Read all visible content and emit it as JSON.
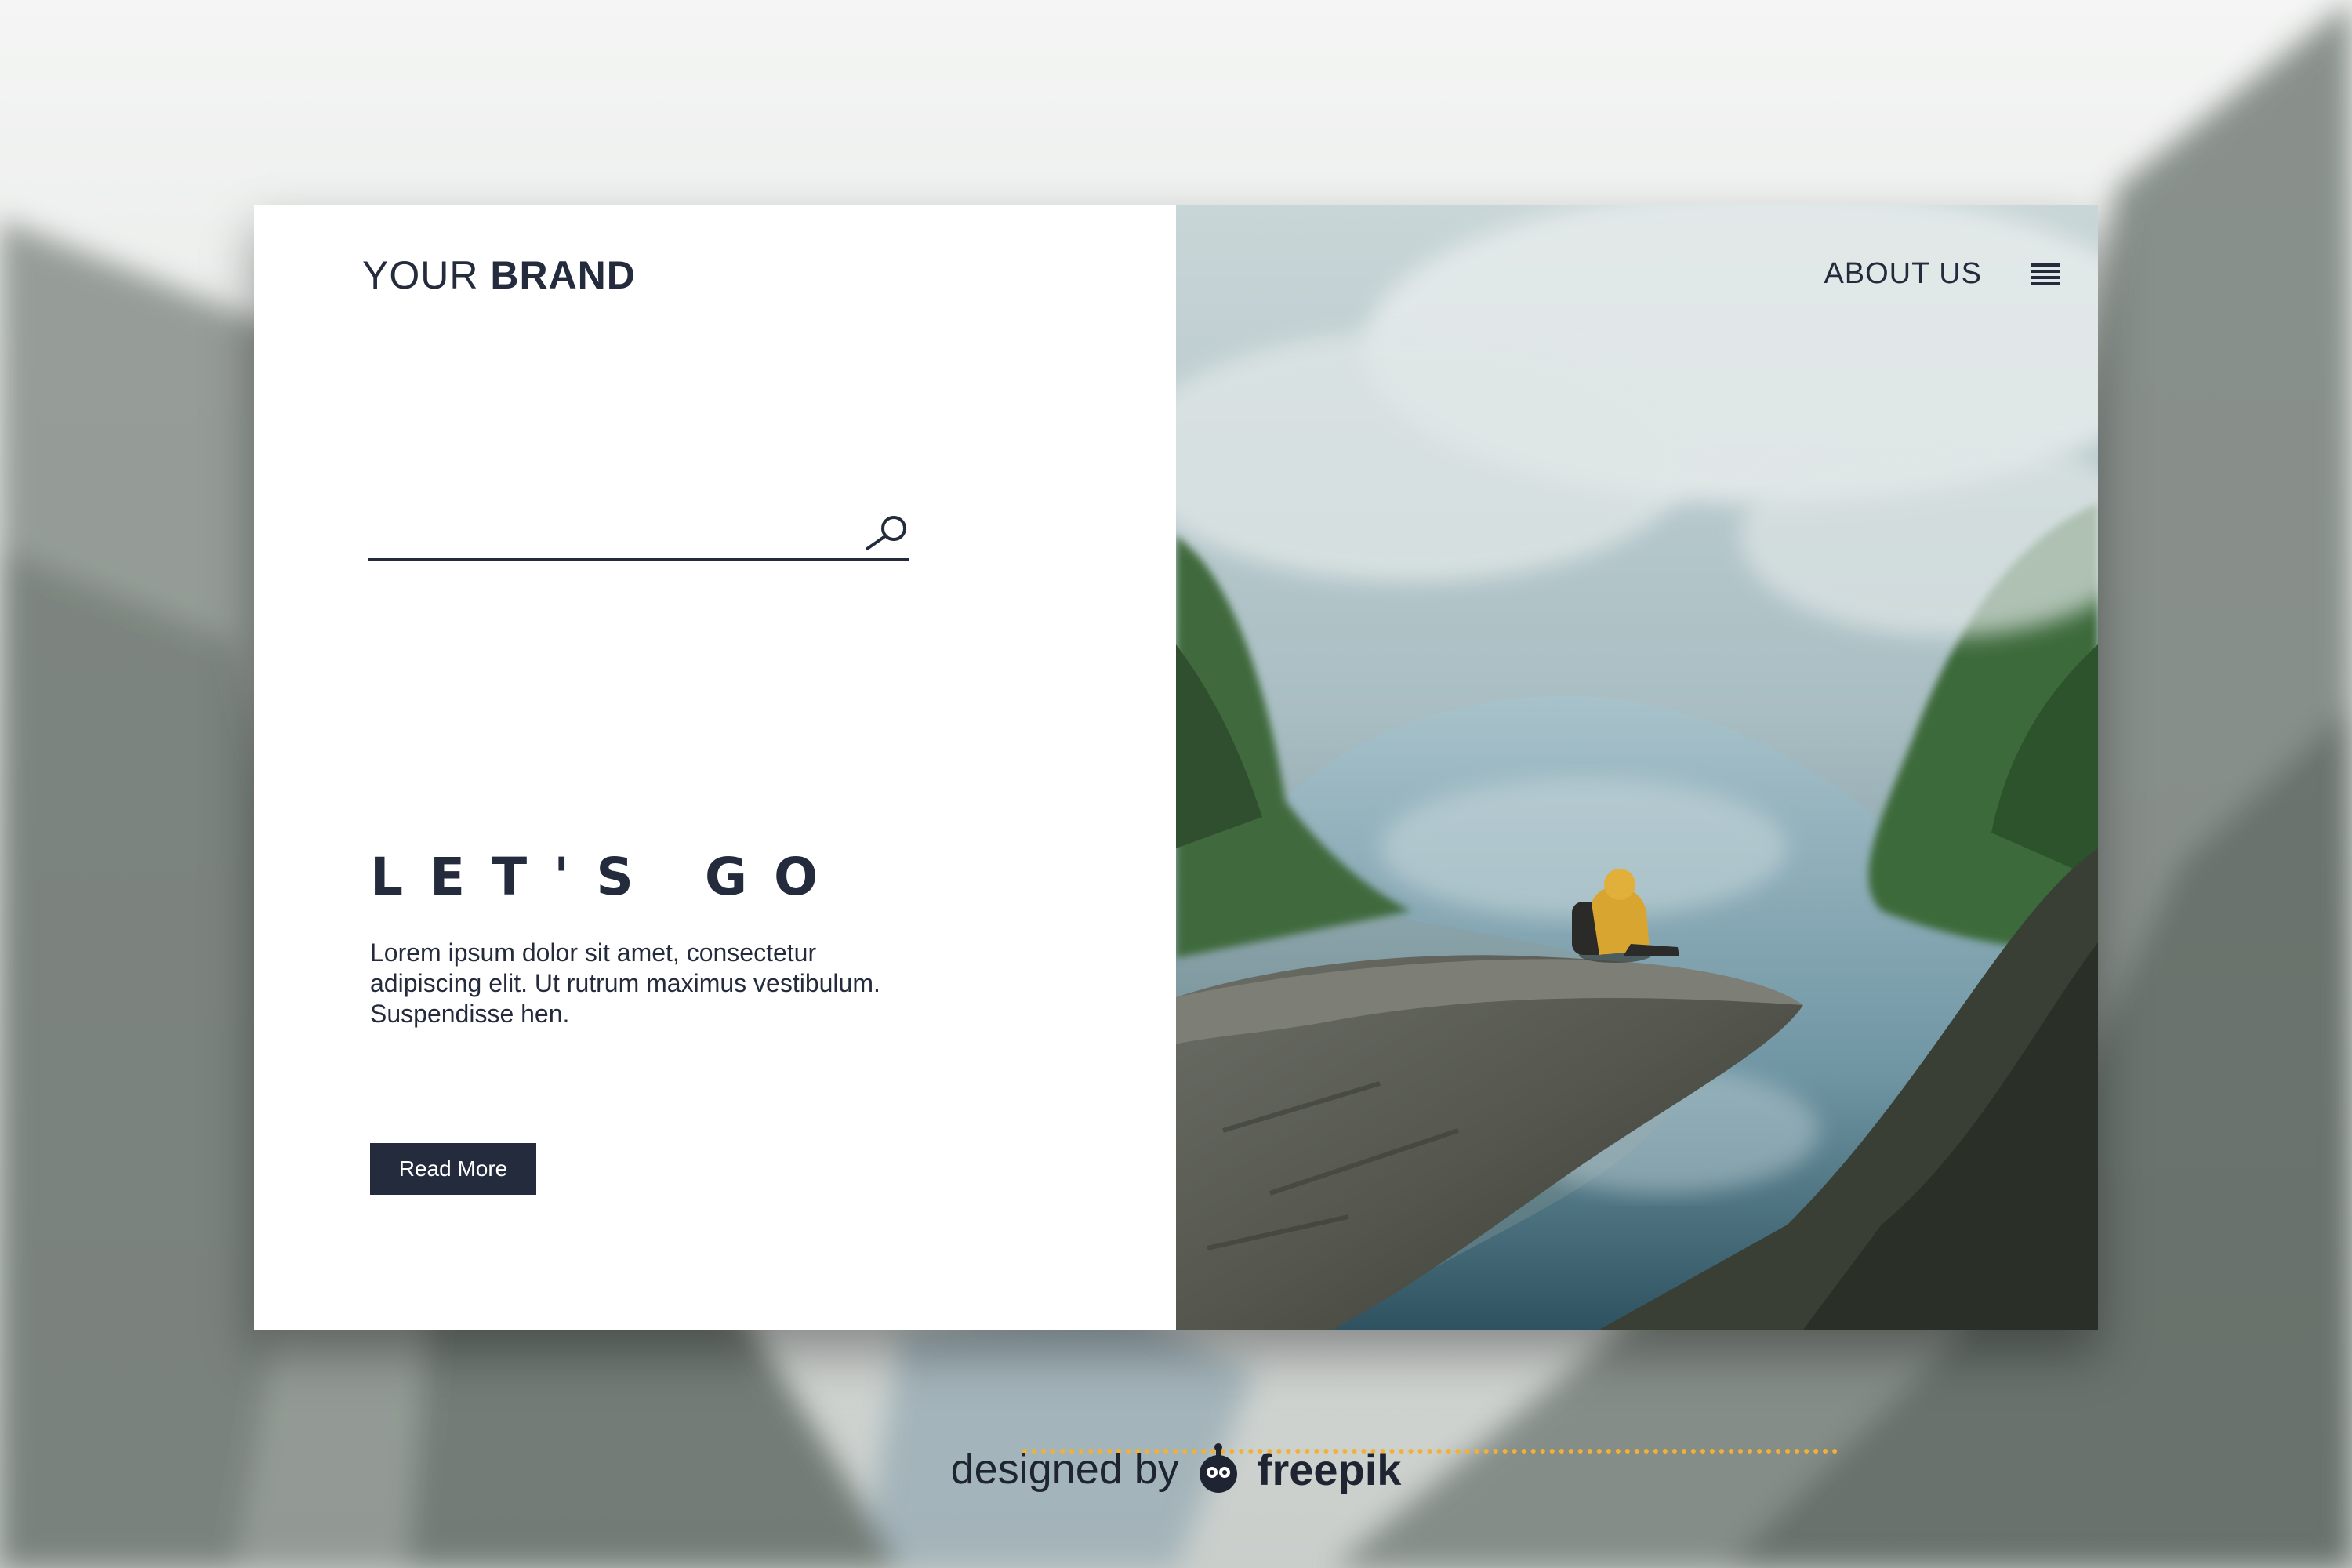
{
  "brand": {
    "light": "YOUR ",
    "bold": "BRAND"
  },
  "nav": {
    "about": "ABOUT US",
    "menu_icon": "hamburger-menu-icon"
  },
  "search": {
    "value": "",
    "placeholder": "",
    "icon": "search-icon"
  },
  "hero": {
    "headline": "LET'S GO",
    "body": "Lorem ipsum dolor sit amet, consectetur adipiscing elit. Ut rutrum maximus vestibulum. Suspendisse hen.",
    "button": "Read More"
  },
  "slider": {
    "prev_icon": "chevron-left-icon",
    "next_icon": "chevron-right-icon"
  },
  "credit": {
    "text": "designed by",
    "brand": "freepik",
    "icon": "freepik-logo-icon"
  },
  "colors": {
    "navy": "#232b3c",
    "accent": "#f2b035",
    "white": "#ffffff"
  }
}
